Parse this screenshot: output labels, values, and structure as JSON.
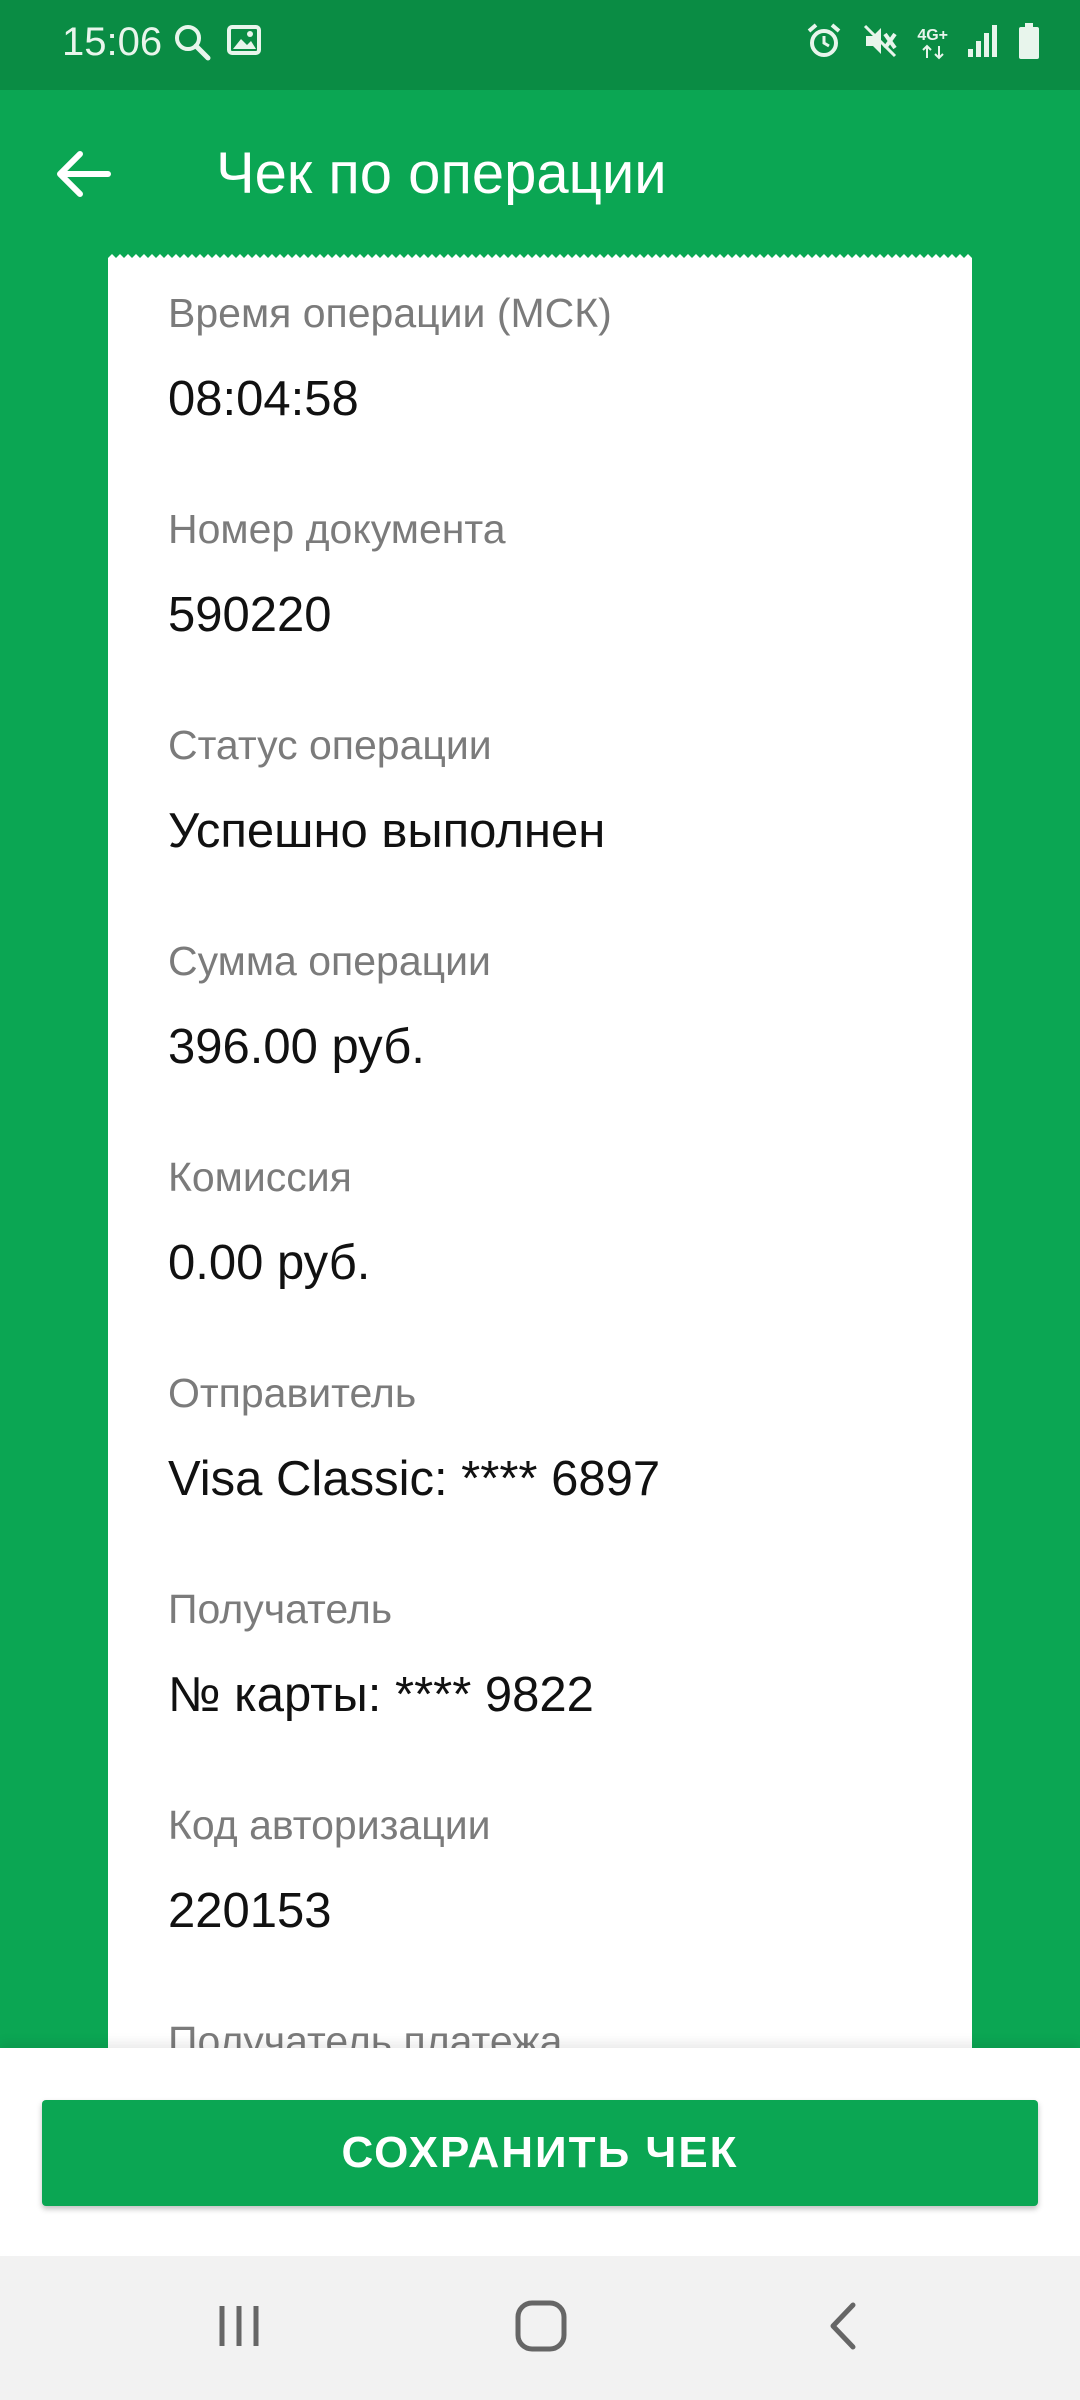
{
  "status_bar": {
    "time": "15:06",
    "left_icons": [
      "search-icon",
      "image-icon"
    ],
    "right_icons": [
      "alarm-icon",
      "mute-icon",
      "4g-data-icon",
      "signal-icon",
      "battery-icon"
    ],
    "network_label": "4G+"
  },
  "header": {
    "title": "Чек по операции",
    "back_icon": "arrow-left-icon"
  },
  "receipt": {
    "fields": [
      {
        "label": "Время операции (МСК)",
        "value": "08:04:58"
      },
      {
        "label": "Номер документа",
        "value": "590220"
      },
      {
        "label": "Статус операции",
        "value": "Успешно выполнен"
      },
      {
        "label": "Сумма операции",
        "value": "396.00 руб."
      },
      {
        "label": "Комиссия",
        "value": "0.00 руб."
      },
      {
        "label": "Отправитель",
        "value": "Visa Classic: **** 6897"
      },
      {
        "label": "Получатель",
        "value": "№ карты: **** 9822"
      },
      {
        "label": "Код авторизации",
        "value": "220153"
      },
      {
        "label": "Получатель платежа",
        "value": ""
      }
    ]
  },
  "actions": {
    "save_label": "СОХРАНИТЬ ЧЕК"
  },
  "nav": {
    "icons": [
      "recent-apps-icon",
      "home-icon",
      "back-icon"
    ]
  },
  "colors": {
    "accent": "#0ba653",
    "status_bar": "#0a8c44",
    "label_text": "#7b7b7b",
    "value_text": "#111111"
  }
}
